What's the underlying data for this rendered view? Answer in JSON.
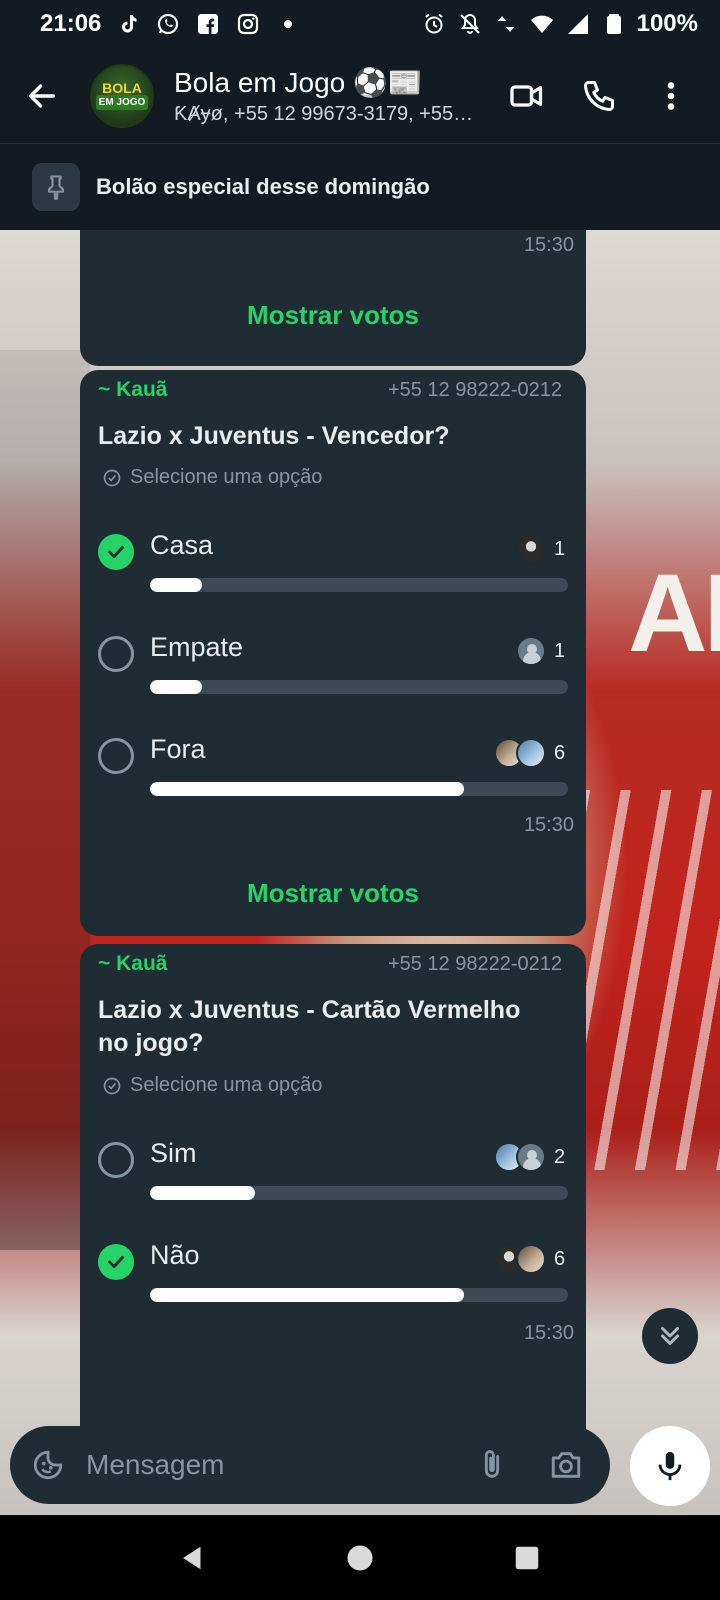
{
  "status_bar": {
    "time": "21:06",
    "battery": "100%",
    "left_icons": [
      "tiktok-icon",
      "whatsapp-icon",
      "facebook-icon",
      "instagram-icon",
      "dot-icon"
    ],
    "right_icons": [
      "alarm-icon",
      "mute-icon",
      "data-icon",
      "wifi-icon",
      "signal-icon",
      "battery-icon"
    ]
  },
  "header": {
    "title": "Bola em Jogo ⚽📰",
    "subtitle": "ƘȺɏø, +55 12 99673-3179, +55 ...",
    "avatar_text_top": "BOLA",
    "avatar_text_bottom": "EM JOGO"
  },
  "pinned": {
    "text": "Bolão especial desse domingão"
  },
  "messages": {
    "first": {
      "time": "15:30",
      "show_votes": "Mostrar votos"
    },
    "poll1": {
      "sender": "~ Kauã",
      "phone": "+55 12 98222-0212",
      "question": "Lazio x Juventus - Vencedor?",
      "hint": "Selecione uma opção",
      "options": [
        {
          "label": "Casa",
          "votes": "1",
          "fraction": 0.125,
          "checked": true
        },
        {
          "label": "Empate",
          "votes": "1",
          "fraction": 0.125,
          "checked": false
        },
        {
          "label": "Fora",
          "votes": "6",
          "fraction": 0.75,
          "checked": false
        }
      ],
      "time": "15:30",
      "show_votes": "Mostrar votos"
    },
    "poll2": {
      "sender": "~ Kauã",
      "phone": "+55 12 98222-0212",
      "question": "Lazio x Juventus - Cartão Vermelho no jogo?",
      "hint": "Selecione uma opção",
      "options": [
        {
          "label": "Sim",
          "votes": "2",
          "fraction": 0.25,
          "checked": false
        },
        {
          "label": "Não",
          "votes": "6",
          "fraction": 0.75,
          "checked": true
        }
      ],
      "time": "15:30"
    }
  },
  "input": {
    "placeholder": "Mensagem"
  },
  "colors": {
    "accent": "#25d366",
    "bubble": "#1f2c34",
    "header": "#111b21"
  }
}
